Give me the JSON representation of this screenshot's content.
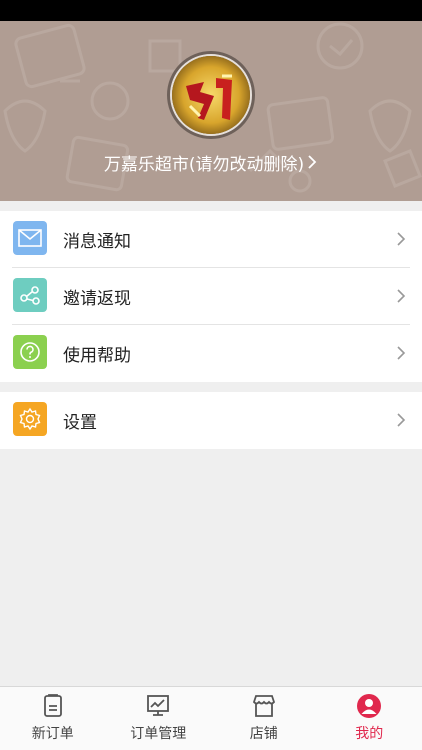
{
  "header": {
    "store_name": "万嘉乐超市(请勿改动删除)",
    "avatar_icon": "store-avatar"
  },
  "menu": {
    "group1": [
      {
        "label": "消息通知",
        "icon": "mail-icon",
        "color": "#7fb6ef"
      },
      {
        "label": "邀请返现",
        "icon": "share-icon",
        "color": "#6ecdc0"
      },
      {
        "label": "使用帮助",
        "icon": "help-icon",
        "color": "#8bd04f"
      }
    ],
    "group2": [
      {
        "label": "设置",
        "icon": "gear-icon",
        "color": "#f5a623"
      }
    ]
  },
  "tabbar": {
    "tabs": [
      {
        "label": "新订单",
        "icon": "new-order-icon"
      },
      {
        "label": "订单管理",
        "icon": "order-manage-icon"
      },
      {
        "label": "店铺",
        "icon": "store-icon"
      },
      {
        "label": "我的",
        "icon": "profile-icon",
        "active": true
      }
    ],
    "active_color": "#e0284d"
  }
}
